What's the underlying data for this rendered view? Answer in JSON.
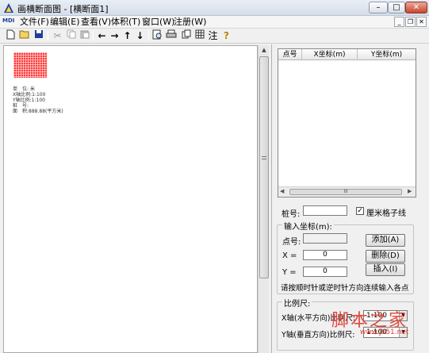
{
  "window": {
    "title": "画横断面图 - [横断面1]"
  },
  "menu": {
    "doc_icon": "MDI",
    "items": [
      "文件(F)",
      "编辑(E)",
      "查看(V)",
      "体积(T)",
      "窗口(W)",
      "注册(W)"
    ]
  },
  "toolbar": {
    "buttons": [
      "new",
      "open",
      "save",
      "cut",
      "copy",
      "paste",
      "left",
      "right",
      "up",
      "down",
      "print-preview",
      "print",
      "copy-view",
      "grid",
      "annotate",
      "help"
    ],
    "label_annotate": "注",
    "arrows": {
      "left": "←",
      "right": "→",
      "up": "↑",
      "down": "↓"
    },
    "help": "?"
  },
  "canvas": {
    "info": [
      "单　位: 米",
      "X轴比例:1:100",
      "Y轴比例:1:100",
      "桩　号:",
      "面　积:888.88(平方米)"
    ]
  },
  "table": {
    "columns": [
      "点号",
      "X坐标(m)",
      "Y坐标(m)"
    ],
    "rows": [],
    "scroll_glyph": "III"
  },
  "station": {
    "label": "桩号:",
    "value": "",
    "checkbox_label": "厘米格子线",
    "checked": true,
    "check_glyph": "✓"
  },
  "input_group": {
    "legend": "输入坐标(m):",
    "point_label": "点号:",
    "point_value": "",
    "x_label": "X =",
    "x_value": "0",
    "y_label": "Y =",
    "y_value": "0",
    "add": "添加(A)",
    "delete": "删除(D)",
    "insert": "插入(I)",
    "hint": "请按顺时针或逆时针方向连续输入各点"
  },
  "scale_group": {
    "legend": "比例尺:",
    "x_label": "X轴(水平方向)比例尺:",
    "x_value": "1:100",
    "y_label": "Y轴(垂直方向)比例尺:",
    "y_value": "1:100"
  },
  "watermark": {
    "text": "脚本之家",
    "url": "www.jb51.net"
  },
  "colors": {
    "grid": "#ff3b3b",
    "watermark": "#e0392d"
  }
}
